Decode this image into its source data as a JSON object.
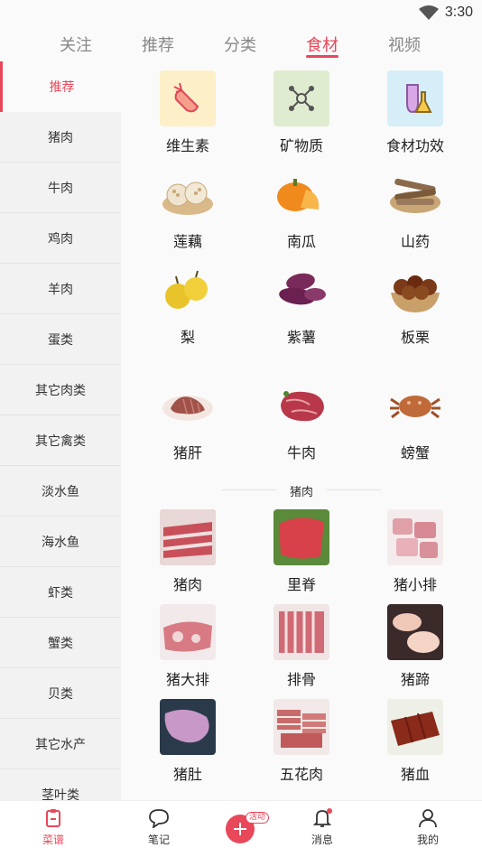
{
  "status": {
    "time": "3:30"
  },
  "top_tabs": [
    {
      "label": "关注",
      "active": false
    },
    {
      "label": "推荐",
      "active": false
    },
    {
      "label": "分类",
      "active": false
    },
    {
      "label": "食材",
      "active": true
    },
    {
      "label": "视频",
      "active": false
    }
  ],
  "sidebar": {
    "items": [
      {
        "label": "推荐",
        "active": true
      },
      {
        "label": "猪肉"
      },
      {
        "label": "牛肉"
      },
      {
        "label": "鸡肉"
      },
      {
        "label": "羊肉"
      },
      {
        "label": "蛋类"
      },
      {
        "label": "其它肉类"
      },
      {
        "label": "其它禽类"
      },
      {
        "label": "淡水鱼"
      },
      {
        "label": "海水鱼"
      },
      {
        "label": "虾类"
      },
      {
        "label": "蟹类"
      },
      {
        "label": "贝类"
      },
      {
        "label": "其它水产"
      },
      {
        "label": "茎叶类"
      }
    ]
  },
  "recommend": {
    "items": [
      {
        "label": "维生素",
        "icon": "carrot-icon",
        "bg": "#fdf0c8"
      },
      {
        "label": "矿物质",
        "icon": "molecule-icon",
        "bg": "#e0ecd0"
      },
      {
        "label": "食材功效",
        "icon": "flask-icon",
        "bg": "#d6eef8"
      },
      {
        "label": "莲藕",
        "icon": "lotus-root-icon"
      },
      {
        "label": "南瓜",
        "icon": "pumpkin-icon"
      },
      {
        "label": "山药",
        "icon": "yam-icon"
      },
      {
        "label": "梨",
        "icon": "pear-icon"
      },
      {
        "label": "紫薯",
        "icon": "purple-potato-icon"
      },
      {
        "label": "板栗",
        "icon": "chestnut-icon"
      },
      {
        "label": "猪肝",
        "icon": "pork-liver-icon"
      },
      {
        "label": "牛肉",
        "icon": "beef-icon"
      },
      {
        "label": "螃蟹",
        "icon": "crab-icon"
      }
    ]
  },
  "pork_section": {
    "title": "猪肉",
    "items": [
      {
        "label": "猪肉"
      },
      {
        "label": "里脊"
      },
      {
        "label": "猪小排"
      },
      {
        "label": "猪大排"
      },
      {
        "label": "排骨"
      },
      {
        "label": "猪蹄"
      },
      {
        "label": "猪肚"
      },
      {
        "label": "五花肉"
      },
      {
        "label": "猪血"
      }
    ]
  },
  "bottom_tabs": [
    {
      "label": "菜谱",
      "icon": "clipboard-icon",
      "active": true
    },
    {
      "label": "笔记",
      "icon": "chat-bubble-icon"
    },
    {
      "label": "消息",
      "icon": "bell-icon"
    },
    {
      "label": "我的",
      "icon": "person-icon"
    }
  ],
  "plus_badge": "活动",
  "colors": {
    "accent": "#e8485a"
  }
}
